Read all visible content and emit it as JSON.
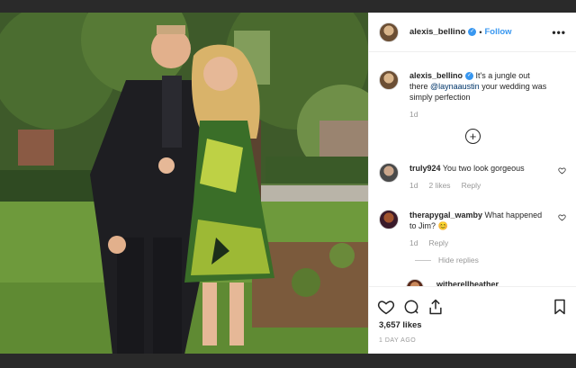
{
  "post": {
    "username": "alexis_bellino",
    "follow_label": "Follow",
    "separator": "•",
    "more_label": "•••"
  },
  "caption": {
    "username": "alexis_bellino",
    "text_before": "It's a jungle out there ",
    "mention": "@laynaaustin",
    "text_after": " your wedding was simply perfection",
    "time": "1d"
  },
  "load_more_label": "+",
  "comments": [
    {
      "username": "truly924",
      "text": "You two look gorgeous",
      "time": "1d",
      "likes": "2 likes",
      "reply_label": "Reply"
    },
    {
      "username": "therapygal_wamby",
      "text": "What happened to Jim? 😊",
      "time": "1d",
      "reply_label": "Reply",
      "hide_replies_label": "Hide replies"
    },
    {
      "username": "witherellheather",
      "text": ""
    }
  ],
  "actions": {
    "likes": "3,657 likes",
    "time": "1 DAY AGO"
  },
  "colors": {
    "link": "#3897f0",
    "mention": "#003569",
    "muted": "#999999"
  }
}
